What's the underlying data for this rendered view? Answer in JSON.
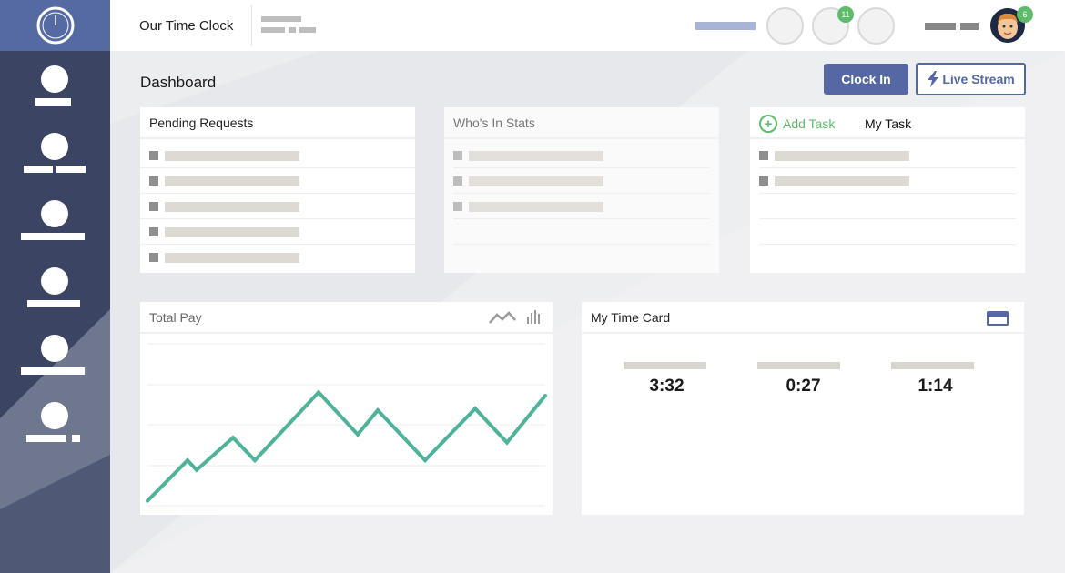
{
  "header": {
    "app_title": "Our Time Clock",
    "notifications": [
      {
        "icon": "notification-circle",
        "badge": ""
      },
      {
        "icon": "notification-circle",
        "badge": "11"
      },
      {
        "icon": "notification-circle",
        "badge": ""
      }
    ],
    "avatar_badge": "6"
  },
  "page": {
    "title": "Dashboard",
    "clock_in_label": "Clock In",
    "live_stream_label": "Live Stream"
  },
  "cards": {
    "pending_requests": {
      "title": "Pending Requests"
    },
    "whos_in": {
      "title": "Who's In Stats"
    },
    "tasks": {
      "add_task_label": "Add Task",
      "my_task_label": "My Task"
    },
    "total_pay": {
      "title": "Total Pay"
    },
    "time_card": {
      "title": "My Time Card",
      "values": [
        "3:32",
        "0:27",
        "1:14"
      ]
    }
  },
  "chart_data": {
    "type": "line",
    "title": "Total Pay",
    "x": [
      0,
      1,
      2,
      3,
      4,
      5,
      6,
      7,
      8,
      9,
      10,
      11,
      12,
      13
    ],
    "values": [
      3,
      28,
      22,
      42,
      28,
      70,
      44,
      59,
      28,
      60,
      39,
      68
    ],
    "ylim": [
      0,
      100
    ],
    "grid": true,
    "series_color": "#4fb39b"
  },
  "colors": {
    "sidebar": "#3b4563",
    "logo_bg": "#5569a3",
    "accent": "#5568a3",
    "green": "#5dbb6a",
    "line": "#4fb39b"
  }
}
